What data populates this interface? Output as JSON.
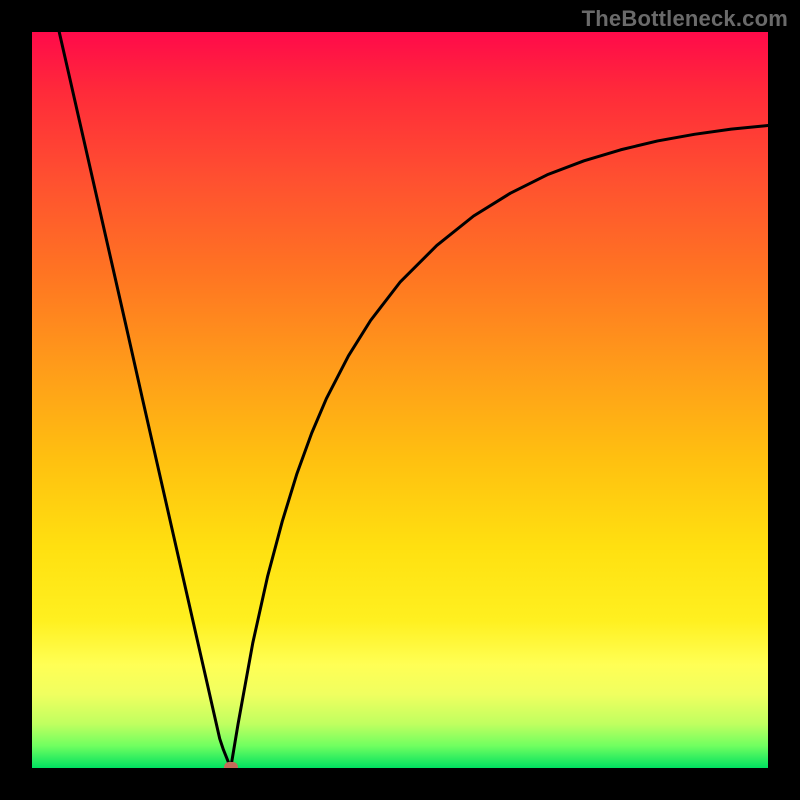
{
  "watermark": "TheBottleneck.com",
  "colors": {
    "curve": "#000000",
    "min_marker": "#c46a5a",
    "frame": "#000000"
  },
  "chart_data": {
    "type": "line",
    "title": "",
    "xlabel": "",
    "ylabel": "",
    "xlim": [
      0,
      100
    ],
    "ylim": [
      0,
      100
    ],
    "grid": false,
    "legend": null,
    "x": [
      3.7,
      5,
      7,
      9,
      11,
      13,
      15,
      17,
      19,
      21,
      22,
      23,
      23.8,
      24.5,
      25,
      25.5,
      26,
      27,
      28,
      30,
      32,
      34,
      36,
      38,
      40,
      43,
      46,
      50,
      55,
      60,
      65,
      70,
      75,
      80,
      85,
      90,
      95,
      100
    ],
    "y": [
      100,
      94.3,
      85.5,
      76.7,
      67.9,
      59.1,
      50.2,
      41.4,
      32.6,
      23.8,
      19.4,
      15.0,
      11.5,
      8.4,
      6.2,
      4.0,
      2.5,
      0,
      6.0,
      17.0,
      26.0,
      33.5,
      40.0,
      45.5,
      50.2,
      56.0,
      60.8,
      66.0,
      71.0,
      75.0,
      78.1,
      80.6,
      82.5,
      84.0,
      85.2,
      86.1,
      86.8,
      87.3
    ],
    "minimum": {
      "x": 27,
      "y": 0
    },
    "description": "Bottleneck-style curve: steep linear descent from top-left to a minimum near x≈27, then an asymptotic rise toward the right. Background is a vertical green→yellow→red gradient (green at bottom = good, red at top = bad)."
  }
}
